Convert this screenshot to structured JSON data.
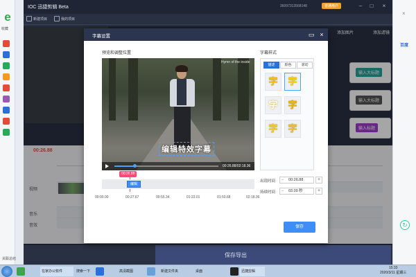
{
  "browser": {
    "favorites_label": "收藏",
    "tab_close": "×",
    "right_tab_label": "百度",
    "status_left": "关联总结"
  },
  "app": {
    "logo": "IOC 迅捷剪辑 Beta",
    "account": "36097313568148",
    "level_badge": "普通用户",
    "new_project": "新建项目",
    "my_project": "我的项目",
    "add_image": "添加图片",
    "add_filter": "添加滤镜",
    "time_display": "00:26.88",
    "track_labels": [
      "视频",
      "音乐",
      "音效"
    ],
    "export_label": "保存导出",
    "tiles": [
      "输入大标题",
      "输入大标题",
      "输入标题"
    ]
  },
  "modal": {
    "title": "字幕设置",
    "preview_title": "预览和调整位置",
    "style_title": "字幕样式",
    "watermark": "Hymn of the inside",
    "subtitle_text": "编辑特效字幕",
    "video_time": "00:26.88/02:18.36",
    "progress": 0.19,
    "playhead_time": "00:26.88",
    "segment_label": "编辑",
    "ruler": [
      "00:00.00",
      "00:27.67",
      "00:55.34",
      "01:23.01",
      "01:50.68",
      "02:18.36"
    ],
    "style_tabs": [
      "描述",
      "颜色",
      "滚动"
    ],
    "style_glyph": "字",
    "appear_time_label": "出现时间",
    "appear_time_value": "00:26.88",
    "duration_label": "持续时间",
    "duration_value": "03.00 秒",
    "save_label": "保存"
  },
  "taskbar": {
    "items": [
      "在家办公软件",
      "搜索一下",
      "高清截图",
      "新建文件夹",
      "桌面",
      "迅捷剪辑"
    ],
    "time": "15:33",
    "date": "2020/3/11 星期三"
  }
}
